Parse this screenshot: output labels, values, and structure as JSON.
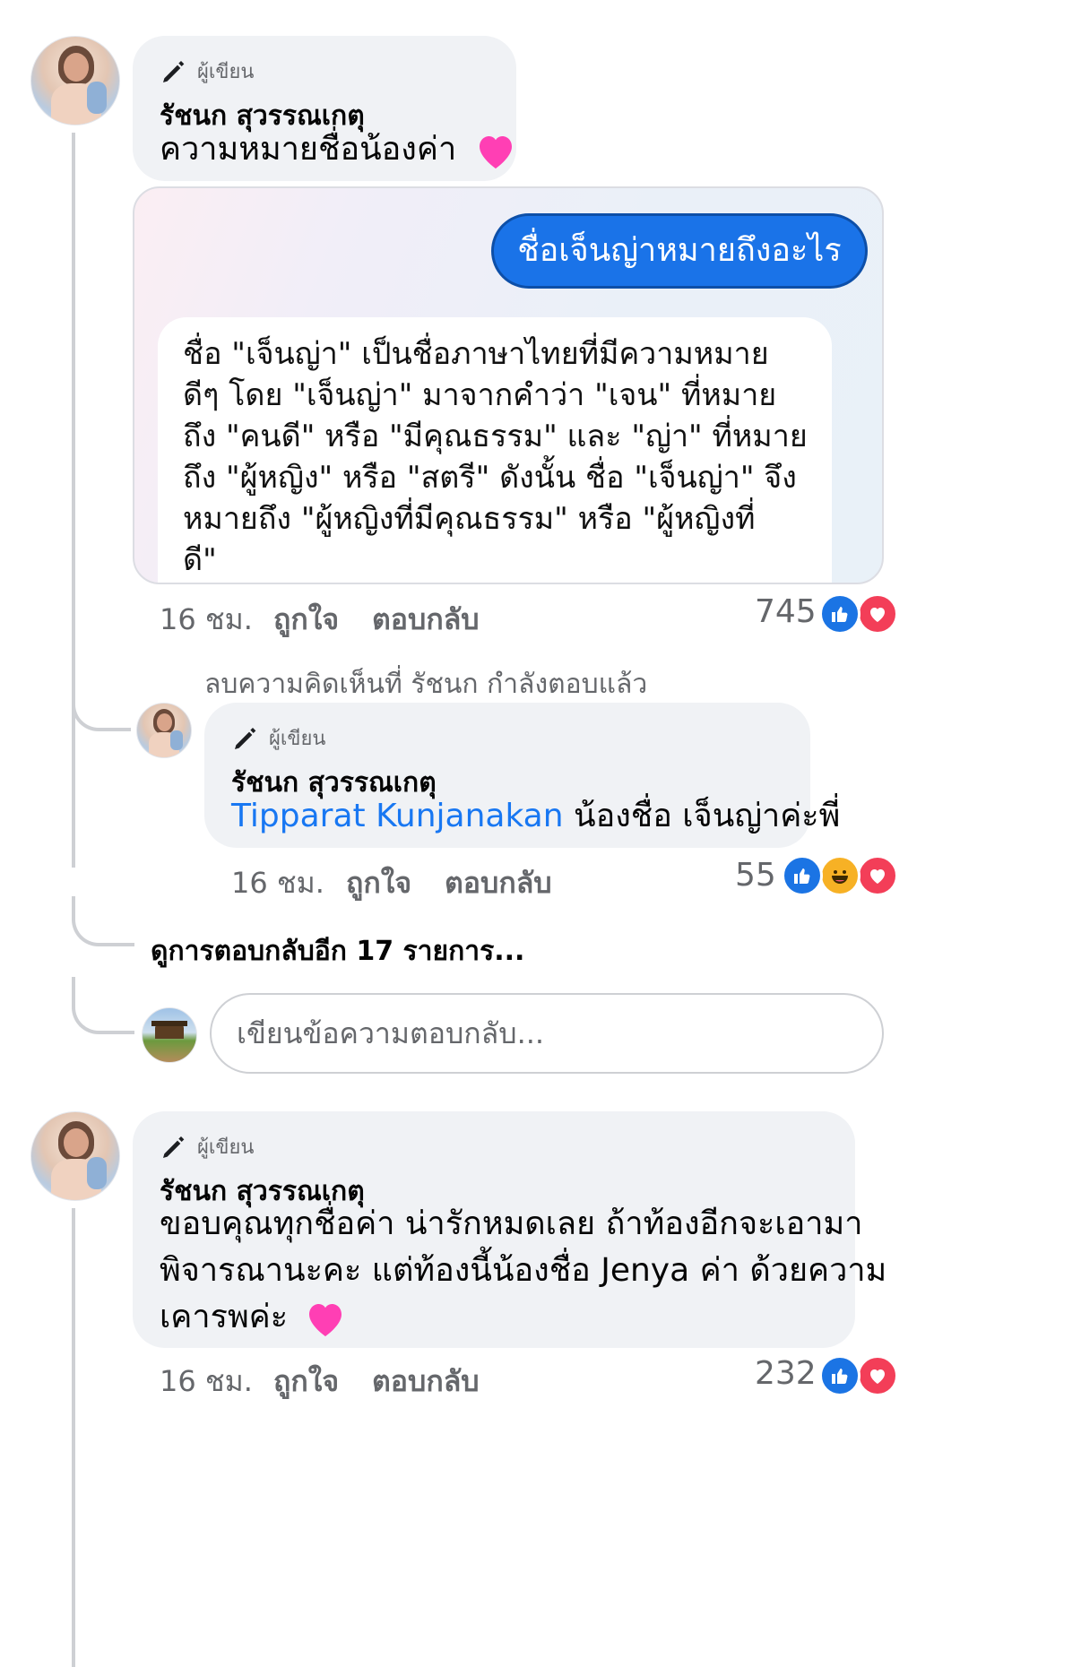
{
  "comments": [
    {
      "badge": "ผู้เขียน",
      "author": "รัชนก สุวรรณเกตุ",
      "text": "ความหมายชื่อน้องค่า",
      "time": "16 ชม.",
      "like_label": "ถูกใจ",
      "reply_label": "ตอบกลับ",
      "reaction_count": "745"
    },
    {
      "badge": "ผู้เขียน",
      "author": "รัชนก สุวรรณเกตุ",
      "text_lines": [
        "ขอบคุณทุกชื่อค่า น่ารักหมดเลย ถ้าท้องอีกจะเอามา",
        "พิจารณานะคะ แต่ท้องนี้น้องชื่อ Jenya ค่า ด้วยความ",
        "เคารพค่ะ"
      ],
      "time": "16 ชม.",
      "like_label": "ถูกใจ",
      "reply_label": "ตอบกลับ",
      "reaction_count": "232"
    }
  ],
  "screenshot": {
    "question": "ชื่อเจ็นญ่าหมายถึงอะไร",
    "answer_lines": [
      "ชื่อ \"เจ็นญ่า\" เป็นชื่อภาษาไทยที่มีความหมาย",
      "ดีๆ โดย \"เจ็นญ่า\" มาจากคำว่า \"เจน\" ที่หมาย",
      "ถึง \"คนดี\" หรือ \"มีคุณธรรม\" และ \"ญ่า\" ที่หมาย",
      "ถึง \"ผู้หญิง\" หรือ \"สตรี\" ดังนั้น ชื่อ \"เจ็นญ่า\" จึง",
      "หมายถึง \"ผู้หญิงที่มีคุณธรรม\" หรือ \"ผู้หญิงที่",
      "ดี\""
    ]
  },
  "deleted_notice": "ลบความคิดเห็นที่ รัชนก กำลังตอบแล้ว",
  "reply": {
    "badge": "ผู้เขียน",
    "author": "รัชนก สุวรรณเกตุ",
    "mention": "Tipparat Kunjanakan",
    "text": "น้องชื่อ เจ็นญ่าค่ะพี่",
    "time": "16 ชม.",
    "like_label": "ถูกใจ",
    "reply_label": "ตอบกลับ",
    "reaction_count": "55"
  },
  "more_replies": "ดูการตอบกลับอีก 17 รายการ...",
  "reply_input": {
    "placeholder": "เขียนข้อความตอบกลับ..."
  },
  "colors": {
    "link": "#1877f2",
    "like": "#1b74e4",
    "love": "#f33e58",
    "haha": "#f7b125",
    "bubble": "#f0f2f5",
    "question_bubble": "#1a73e8"
  }
}
